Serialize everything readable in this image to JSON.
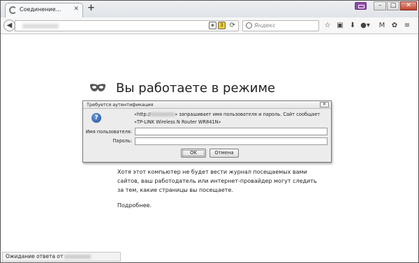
{
  "browser": {
    "tab_title": "Соединение...",
    "tab_close": "✕",
    "new_tab": "+",
    "search_placeholder": "Яндекс",
    "url_icon_badge": "3",
    "window_min": "–",
    "window_max": "□",
    "window_close": "✕"
  },
  "page": {
    "heading": "Вы работаете в режиме",
    "paragraph": "Хотя этот компьютер не будет вести журнал посещаемых вами сайтов, ваш работодатель или интернет-провайдер могут следить за тем, какие страницы вы посещаете.",
    "more_link": "Подробнее."
  },
  "status": {
    "text": "Ожидание ответа от"
  },
  "dialog": {
    "title": "Требуется аутентификация",
    "message_prefix": "«http://",
    "message_suffix": "» запрашивает имя пользователя и пароль. Сайт сообщает «TP-LINK Wireless N Router WR841N»",
    "username_label": "Имя пользователя:",
    "password_label": "Пароль:",
    "username_value": "",
    "password_value": "",
    "ok_label": "OK",
    "cancel_label": "Отмена",
    "close": "✕"
  },
  "colors": {
    "private_accent": "#8d4ca5"
  }
}
